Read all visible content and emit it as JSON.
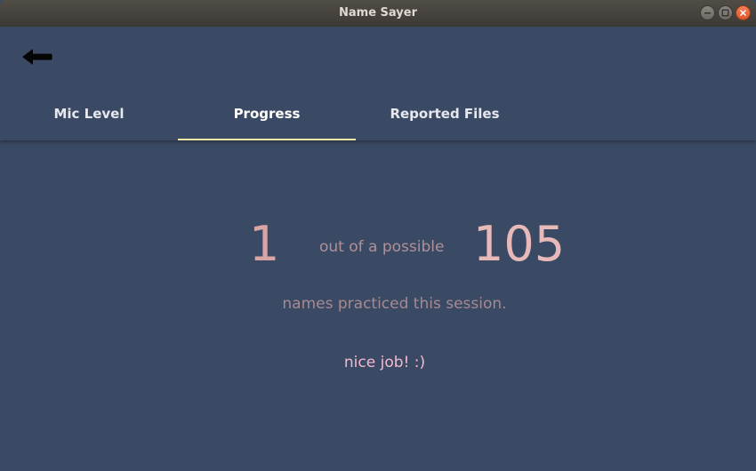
{
  "window": {
    "title": "Name Sayer",
    "controls": [
      "minimize-icon",
      "maximize-icon",
      "close-icon"
    ]
  },
  "header": {
    "back_icon": "back-arrow-icon",
    "tabs": [
      {
        "label": "Mic Level",
        "active": false
      },
      {
        "label": "Progress",
        "active": true
      },
      {
        "label": "Reported Files",
        "active": false
      }
    ],
    "active_tab_indicator_color": "#f4f0a8"
  },
  "progress": {
    "practiced_count": "1",
    "connector_text": "out of a possible",
    "total_count": "105",
    "session_text": "names practiced this session.",
    "encouragement": "nice job! :)"
  },
  "colors": {
    "background": "#3b4a64",
    "count_color": "#d9a4a4",
    "muted_text": "#a58a92",
    "encouragement": "#f3b9d0"
  }
}
